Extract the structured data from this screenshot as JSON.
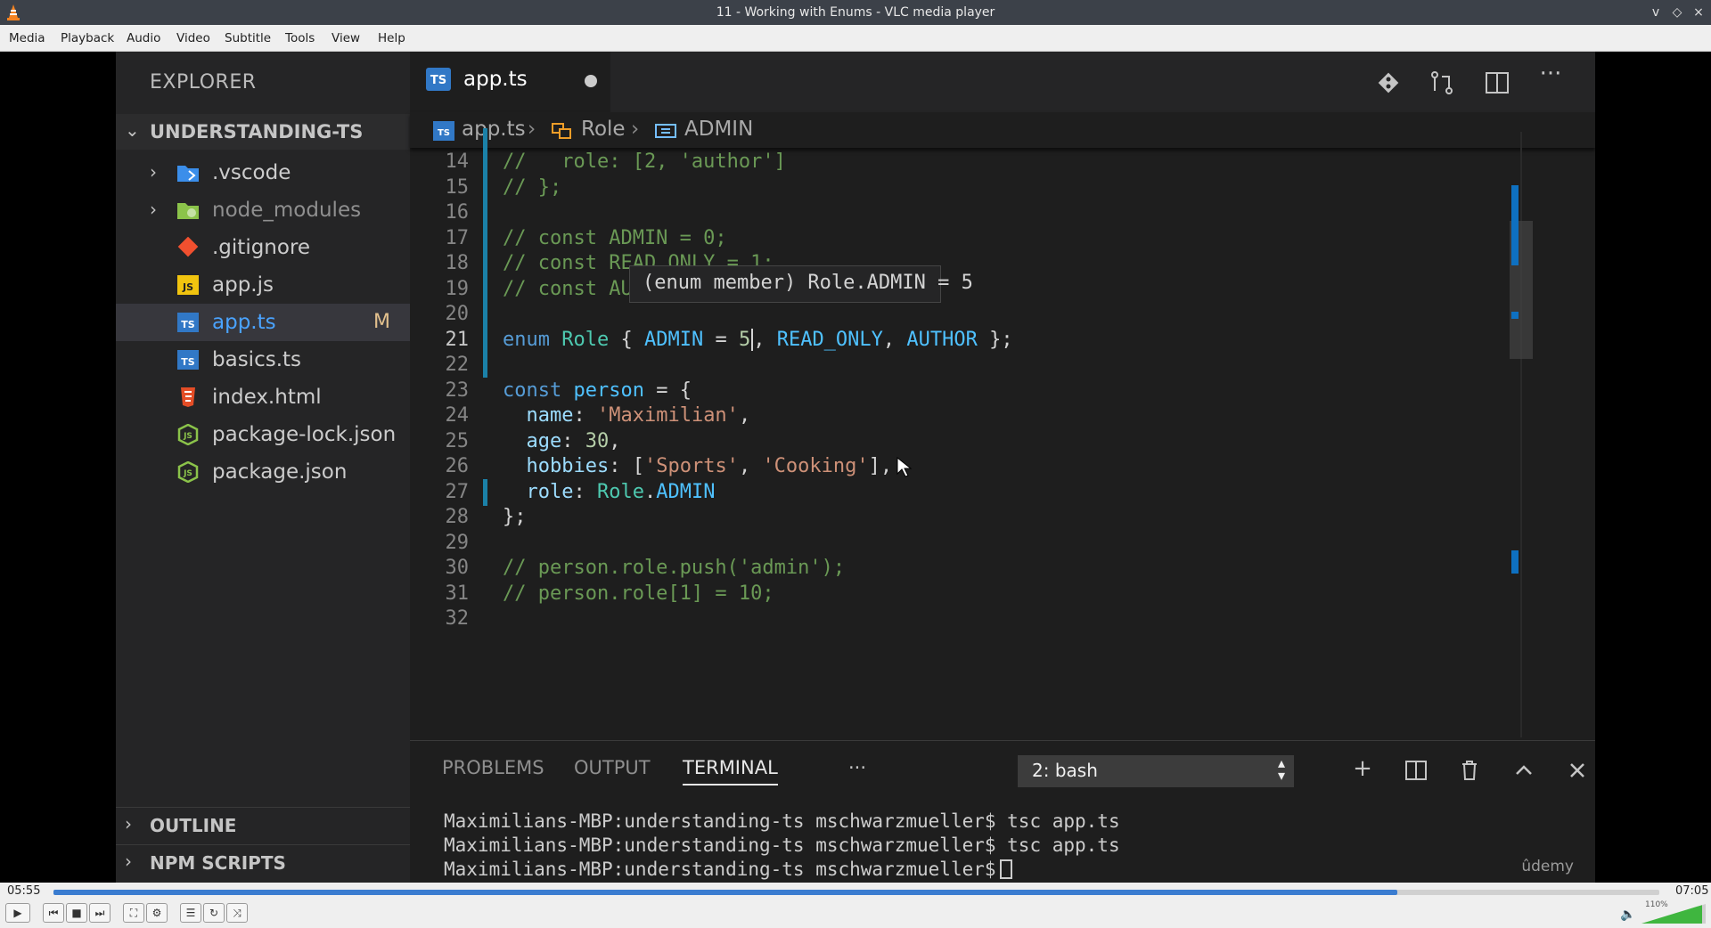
{
  "window": {
    "title": "11 - Working with Enums - VLC media player",
    "controls": [
      "v",
      "◇",
      "×"
    ]
  },
  "menu": [
    "Media",
    "Playback",
    "Audio",
    "Video",
    "Subtitle",
    "Tools",
    "View",
    "Help"
  ],
  "vscode": {
    "explorer": {
      "title": "EXPLORER",
      "project": "UNDERSTANDING-TS",
      "files": [
        {
          "name": ".vscode",
          "kind": "folder",
          "icon": "vscode-folder-icon",
          "color": "#3b8eea"
        },
        {
          "name": "node_modules",
          "kind": "folder",
          "icon": "node-modules-folder-icon",
          "color": "#8bc34a"
        },
        {
          "name": ".gitignore",
          "kind": "file",
          "icon": "git-icon",
          "color": "#f1502f"
        },
        {
          "name": "app.js",
          "kind": "file",
          "icon": "js-file-icon",
          "color": "#f1c40f"
        },
        {
          "name": "app.ts",
          "kind": "file",
          "icon": "ts-file-icon",
          "color": "#3178c6",
          "badge": "M",
          "selected": true
        },
        {
          "name": "basics.ts",
          "kind": "file",
          "icon": "ts-file-icon",
          "color": "#3178c6"
        },
        {
          "name": "index.html",
          "kind": "file",
          "icon": "html-file-icon",
          "color": "#e44d26"
        },
        {
          "name": "package-lock.json",
          "kind": "file",
          "icon": "npm-json-icon",
          "color": "#8bc34a"
        },
        {
          "name": "package.json",
          "kind": "file",
          "icon": "npm-json-icon",
          "color": "#8bc34a"
        }
      ],
      "sections": [
        "OUTLINE",
        "NPM SCRIPTS"
      ]
    },
    "tab": {
      "icon_text": "TS",
      "name": "app.ts"
    },
    "breadcrumb": [
      "app.ts",
      "Role",
      "ADMIN"
    ],
    "hover_tooltip": "(enum member) Role.ADMIN = 5",
    "line_numbers": [
      "14",
      "15",
      "16",
      "17",
      "18",
      "19",
      "20",
      "21",
      "22",
      "23",
      "24",
      "25",
      "26",
      "27",
      "28",
      "29",
      "30",
      "31",
      "32"
    ],
    "code": {
      "l14": "//   role: [2, 'author']",
      "l15": "// };",
      "l17": "// const ADMIN = 0;",
      "l18": "// const READ_ONLY = 1;",
      "l19": "// const AUTHOR = 2;",
      "l21_kw": "enum",
      "l21_type": "Role",
      "l21_a": " { ",
      "l21_admin": "ADMIN",
      "l21_eq": " = ",
      "l21_num": "5",
      "l21_b": ", ",
      "l21_ro": "READ_ONLY",
      "l21_c": ", ",
      "l21_author": "AUTHOR",
      "l21_d": " };",
      "l23_kw": "const",
      "l23_var": "person",
      "l23_rest": " = {",
      "l24_key": "name",
      "l24_val": "'Maximilian'",
      "l25_key": "age",
      "l25_val": "30",
      "l26_key": "hobbies",
      "l26_v1": "'Sports'",
      "l26_v2": "'Cooking'",
      "l27_key": "role",
      "l27_obj": "Role",
      "l27_prop": "ADMIN",
      "l28": "};",
      "l30": "// person.role.push('admin');",
      "l31": "// person.role[1] = 10;"
    },
    "panel": {
      "tabs": [
        "PROBLEMS",
        "OUTPUT",
        "TERMINAL",
        "···"
      ],
      "active_tab": "TERMINAL",
      "shell": "2: bash",
      "terminal_lines": [
        "Maximilians-MBP:understanding-ts mschwarzmueller$ tsc app.ts",
        "Maximilians-MBP:understanding-ts mschwarzmueller$ tsc app.ts",
        "Maximilians-MBP:understanding-ts mschwarzmueller$"
      ],
      "watermark": "ûdemy"
    }
  },
  "player": {
    "elapsed": "05:55",
    "total": "07:05",
    "progress": 0.837,
    "volume_label": "110%"
  }
}
